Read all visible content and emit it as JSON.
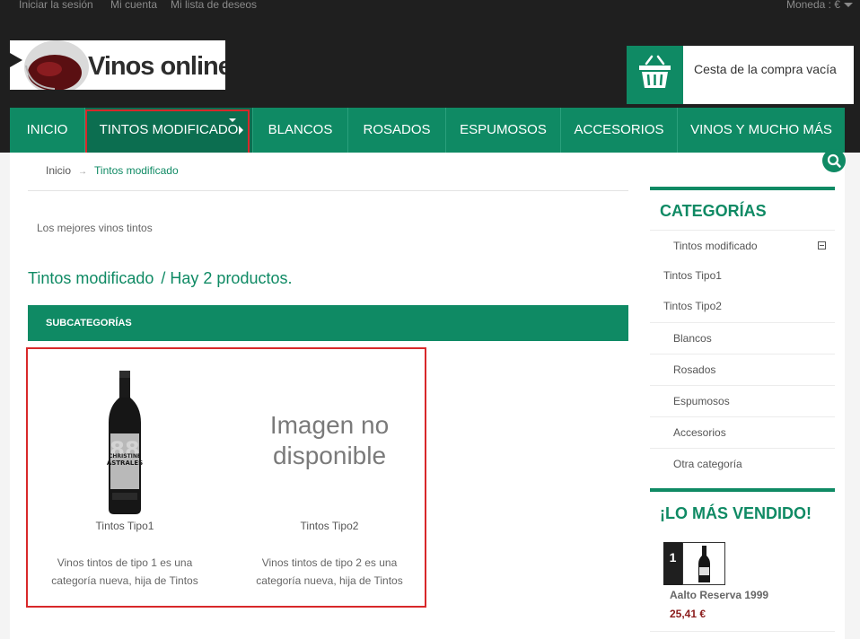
{
  "topbar": {
    "login": "Iniciar la sesión",
    "account": "Mi cuenta",
    "wishlist": "Mi lista de deseos",
    "currency": "Moneda : €"
  },
  "logo": {
    "text": "Vinos online"
  },
  "cart": {
    "label": "Cesta de la compra vacía"
  },
  "nav": {
    "items": [
      "INICIO",
      "TINTOS MODIFICADO",
      "BLANCOS",
      "ROSADOS",
      "ESPUMOSOS",
      "ACCESORIOS",
      "VINOS Y MUCHO MÁS"
    ],
    "active_index": 1
  },
  "breadcrumb": {
    "home": "Inicio",
    "separator": "→",
    "current": "Tintos modificado"
  },
  "category": {
    "description": "Los mejores vinos tintos",
    "name": "Tintos modificado",
    "count_text": "/ Hay 2 productos."
  },
  "subcategories": {
    "title": "SUBCATEGORÍAS",
    "items": [
      {
        "name": "Tintos Tipo1",
        "description": "Vinos tintos de tipo 1 es una categoría nueva, hija de Tintos",
        "image": "wine-bottle",
        "label_text": "CHRISTINE ASTRALES"
      },
      {
        "name": "Tintos Tipo2",
        "description": "Vinos tintos de tipo 2 es una categoría nueva, hija de Tintos",
        "image_placeholder": "Imagen no disponible"
      }
    ]
  },
  "sidebar": {
    "categories_title": "CATEGORÍAS",
    "categories": [
      {
        "label": "Tintos modificado",
        "level": 1,
        "expanded": true
      },
      {
        "label": "Tintos Tipo1",
        "level": 2
      },
      {
        "label": "Tintos Tipo2",
        "level": 2
      },
      {
        "label": "Blancos",
        "level": 1
      },
      {
        "label": "Rosados",
        "level": 1
      },
      {
        "label": "Espumosos",
        "level": 1
      },
      {
        "label": "Accesorios",
        "level": 1
      },
      {
        "label": "Otra categoría",
        "level": 1
      }
    ],
    "bestsellers_title": "¡LO MÁS VENDIDO!",
    "bestsellers": [
      {
        "rank": "1",
        "name": "Aalto Reserva 1999",
        "price": "25,41 €"
      }
    ]
  },
  "colors": {
    "accent": "#0f8a64",
    "header_bg": "#1f1f1f",
    "highlight": "#d8282a",
    "price": "#8b1b1b"
  },
  "icons": [
    "basket-icon",
    "search-icon",
    "collapse-icon",
    "chevron-right-icon",
    "caret-down-icon",
    "arrow-separator-icon"
  ]
}
